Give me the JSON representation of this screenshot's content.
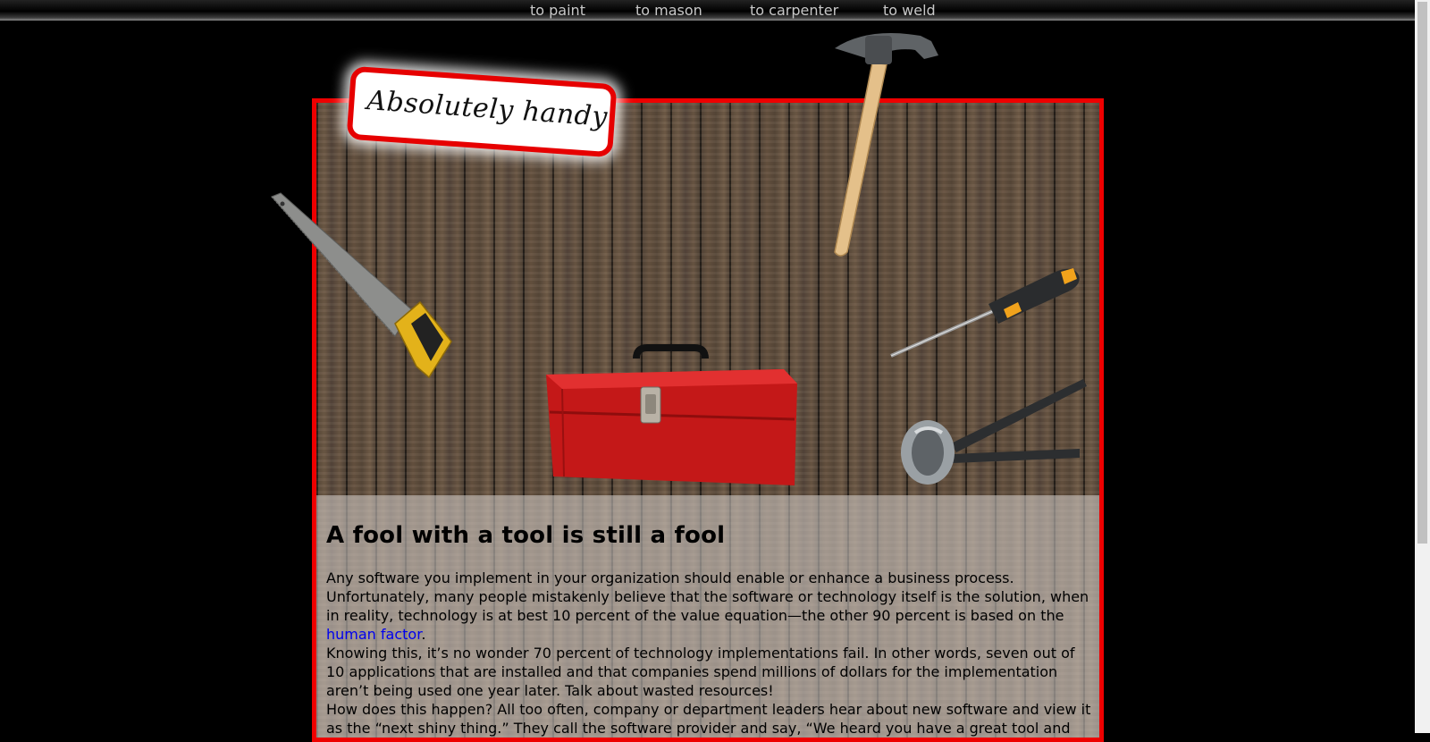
{
  "nav": {
    "items": [
      {
        "label": "to paint"
      },
      {
        "label": "to mason"
      },
      {
        "label": "to carpenter"
      },
      {
        "label": "to weld"
      }
    ]
  },
  "logo": {
    "text": "Absolutely handy"
  },
  "article": {
    "heading": "A fool with a tool is still a fool",
    "p1_before_link": "Any software you implement in your organization should enable or enhance a business process. Unfortunately, many people mistakenly believe that the software or technology itself is the solution, when in reality, technology is at best 10 percent of the value equation—the other 90 percent is based on the ",
    "p1_link": "human factor",
    "p1_after_link": ".",
    "p2": "Knowing this, it’s no wonder 70 percent of technology implementations fail. In other words, seven out of 10 applications that are installed and that companies spend millions of dollars for the implementation aren’t being used one year later. Talk about wasted resources!",
    "p3": "How does this happen? All too often, company or department leaders hear about new software and view it as the “next shiny thing.” They call the software provider and say, “We heard you have a great tool and we’d like a demonstration.” The software is certainly seductive with its bells and whistles, but its effectiveness and"
  },
  "icons": [
    "hammer-icon",
    "saw-icon",
    "screwdriver-icon",
    "pliers-icon",
    "toolbox-icon"
  ],
  "colors": {
    "frame": "#ee0000",
    "link": "#0000ee",
    "background": "#000000"
  }
}
